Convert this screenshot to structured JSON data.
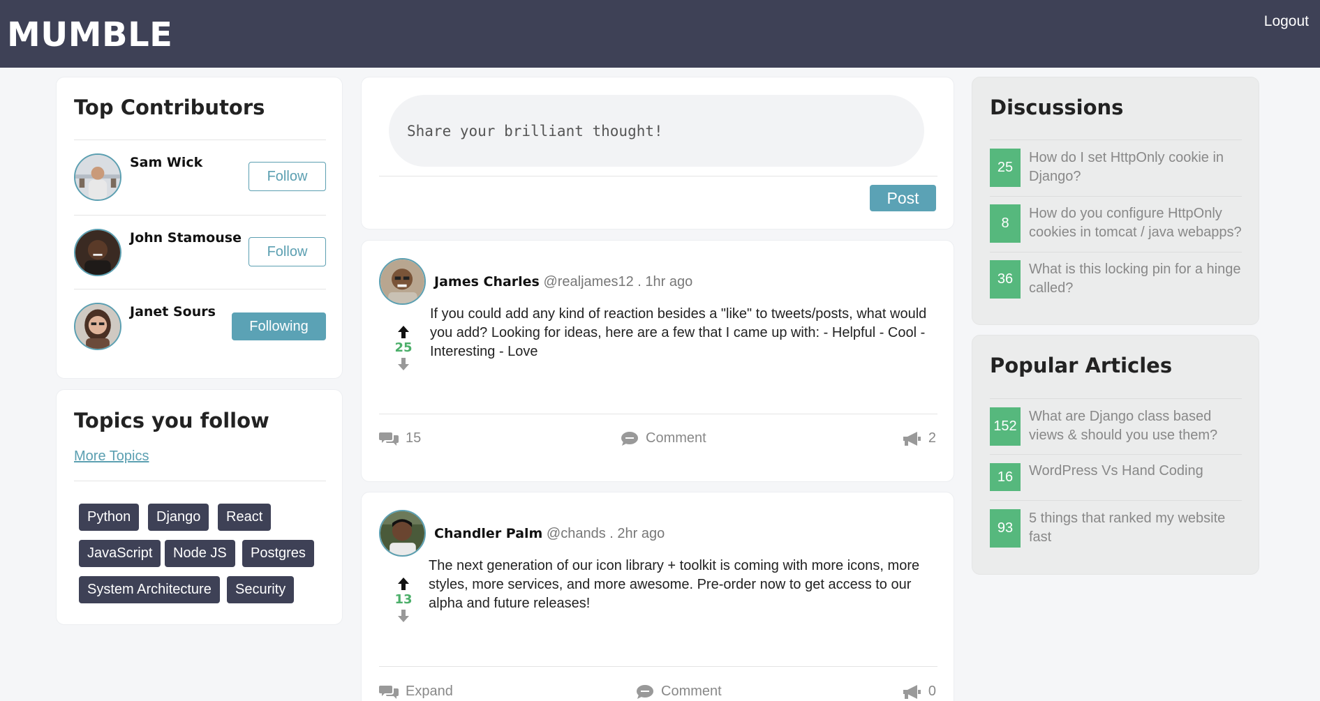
{
  "navbar": {
    "logo": "MUMBLE",
    "logout": "Logout"
  },
  "contributors": {
    "title": "Top Contributors",
    "items": [
      {
        "name": "Sam Wick",
        "button": "Follow",
        "following": false
      },
      {
        "name": "John Stamouse",
        "button": "Follow",
        "following": false
      },
      {
        "name": "Janet Sours",
        "button": "Following",
        "following": true
      }
    ]
  },
  "topics": {
    "title": "Topics you follow",
    "more": "More Topics",
    "tags": [
      "Python",
      "Django",
      "React",
      "JavaScript",
      "Node JS",
      "Postgres",
      "System Architecture",
      "Security"
    ]
  },
  "composer": {
    "placeholder": "Share your brilliant thought!",
    "post": "Post"
  },
  "posts": [
    {
      "author": "James Charles",
      "handle": "@realjames12",
      "time": ". 1hr ago",
      "votes": "25",
      "body": "If you could add any kind of reaction besides a \"like\" to tweets/posts, what would you add? Looking for ideas, here are a few that I came up with: - Helpful - Cool - Interesting - Love",
      "replies": "15",
      "comment": "Comment",
      "shares": "2"
    },
    {
      "author": "Chandler Palm",
      "handle": "@chands",
      "time": ". 2hr ago",
      "votes": "13",
      "body": "The next generation of our icon library + toolkit is coming with more icons, more styles, more services, and more awesome. Pre-order now to get access to our alpha and future releases!",
      "replies": "Expand",
      "comment": "Comment",
      "shares": "0"
    }
  ],
  "discussions": {
    "title": "Discussions",
    "items": [
      {
        "count": "25",
        "text": "How do I set HttpOnly cookie in Django?"
      },
      {
        "count": "8",
        "text": "How do you configure HttpOnly cookies in tomcat / java webapps?"
      },
      {
        "count": "36",
        "text": "What is this locking pin for a hinge called?"
      }
    ]
  },
  "articles": {
    "title": "Popular Articles",
    "items": [
      {
        "count": "152",
        "text": "What are Django class based views & should you use them?"
      },
      {
        "count": "16",
        "text": "WordPress Vs Hand Coding"
      },
      {
        "count": "93",
        "text": "5 things that ranked my website fast"
      }
    ]
  },
  "colors": {
    "navbar": "#3e4156",
    "accent": "#5ba2b5",
    "badge": "#56b87d",
    "vote": "#4caf6a"
  }
}
